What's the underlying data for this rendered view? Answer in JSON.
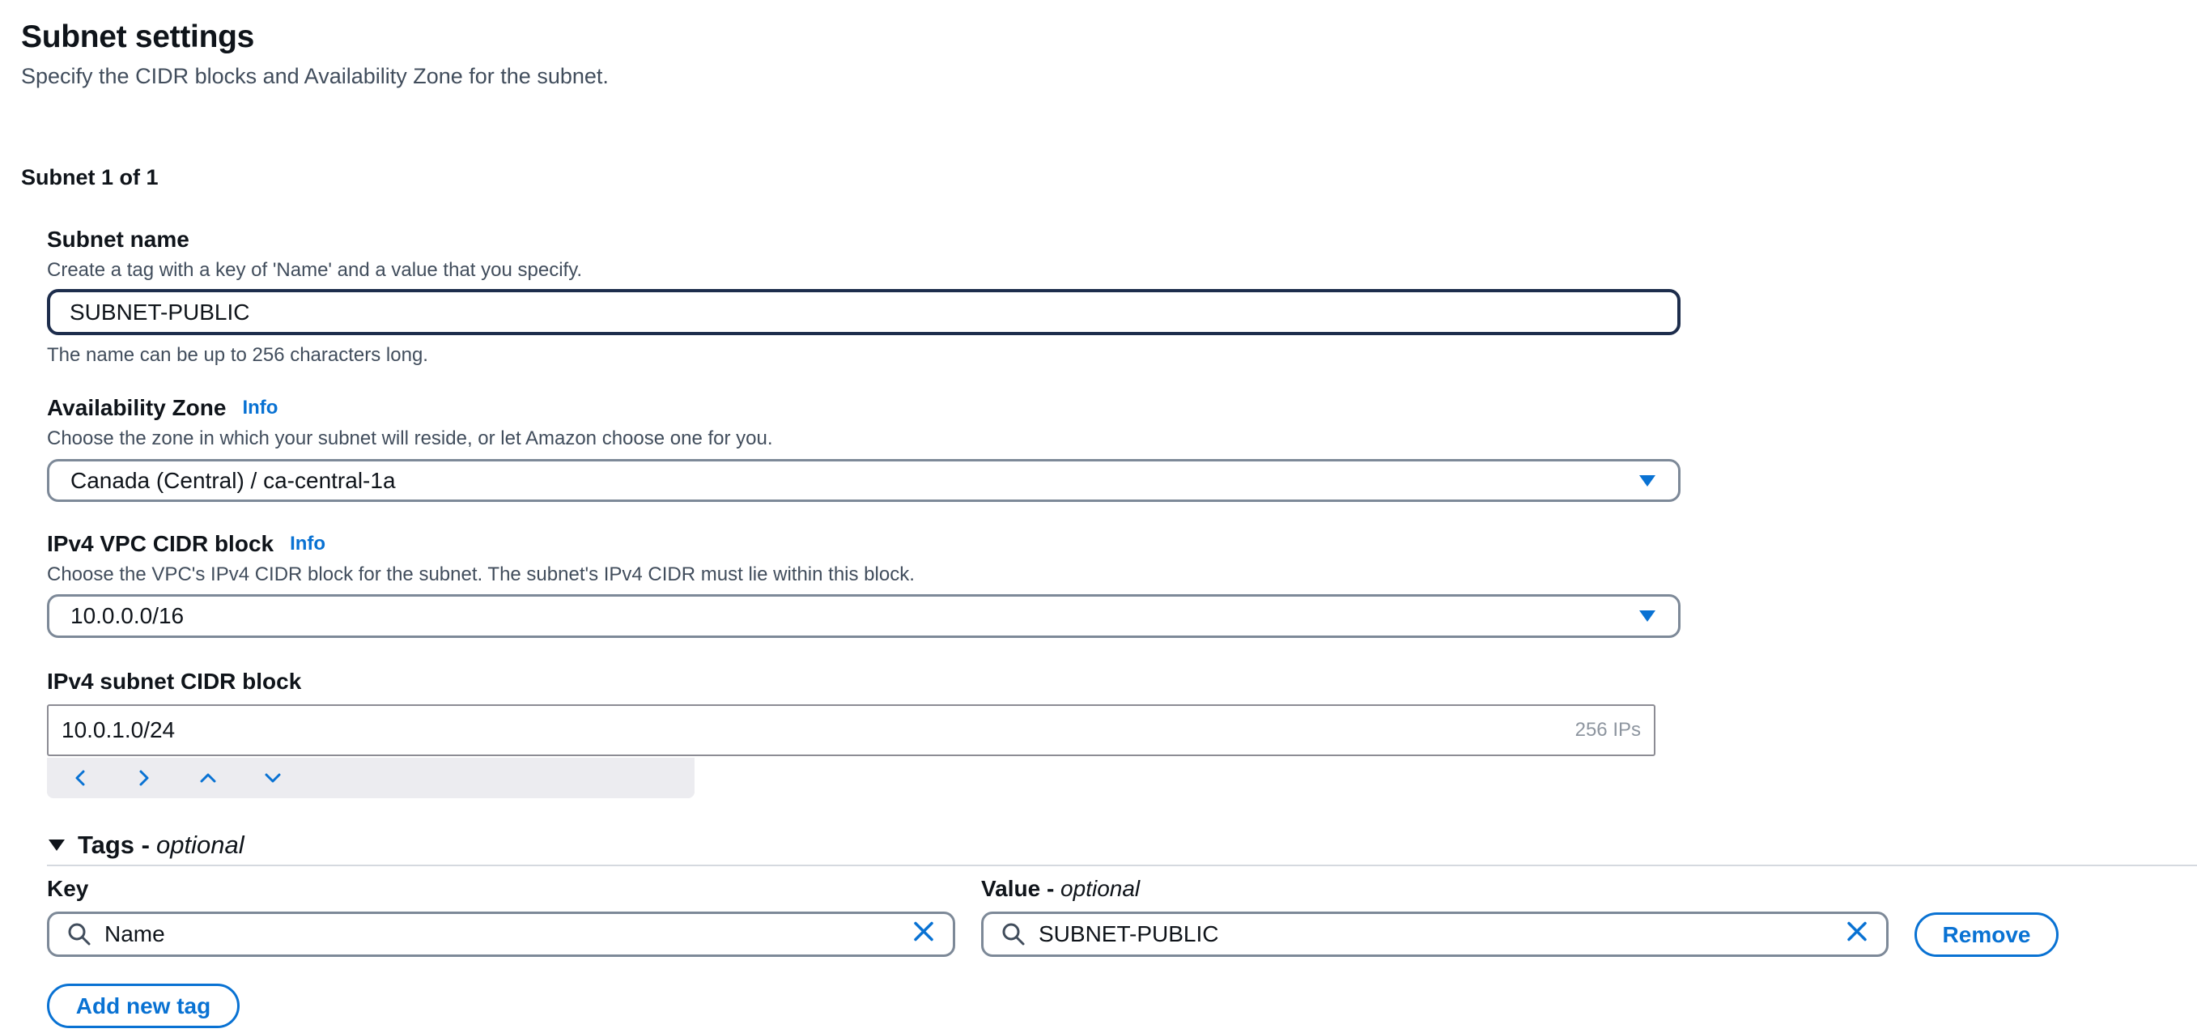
{
  "header": {
    "title": "Subnet settings",
    "description": "Specify the CIDR blocks and Availability Zone for the subnet."
  },
  "subnet_counter": "Subnet 1 of 1",
  "subnet_name": {
    "label": "Subnet name",
    "description": "Create a tag with a key of 'Name' and a value that you specify.",
    "value": "SUBNET-PUBLIC",
    "constraint": "The name can be up to 256 characters long."
  },
  "availability_zone": {
    "label": "Availability Zone",
    "info": "Info",
    "description": "Choose the zone in which your subnet will reside, or let Amazon choose one for you.",
    "selected": "Canada (Central) / ca-central-1a"
  },
  "vpc_cidr": {
    "label": "IPv4 VPC CIDR block",
    "info": "Info",
    "description": "Choose the VPC's IPv4 CIDR block for the subnet. The subnet's IPv4 CIDR must lie within this block.",
    "selected": "10.0.0.0/16"
  },
  "subnet_cidr": {
    "label": "IPv4 subnet CIDR block",
    "value": "10.0.1.0/24",
    "ip_count": "256 IPs"
  },
  "tags": {
    "title": "Tags - ",
    "title_optional": "optional",
    "key_label": "Key",
    "value_label": "Value - ",
    "value_label_optional": "optional",
    "key_value": "Name",
    "value_value": "SUBNET-PUBLIC",
    "remove_label": "Remove",
    "add_label": "Add new tag"
  },
  "colors": {
    "accent": "#0972d3",
    "focus_border": "#1d2d4c",
    "text": "#0f141a",
    "muted_text": "#414d5c"
  }
}
